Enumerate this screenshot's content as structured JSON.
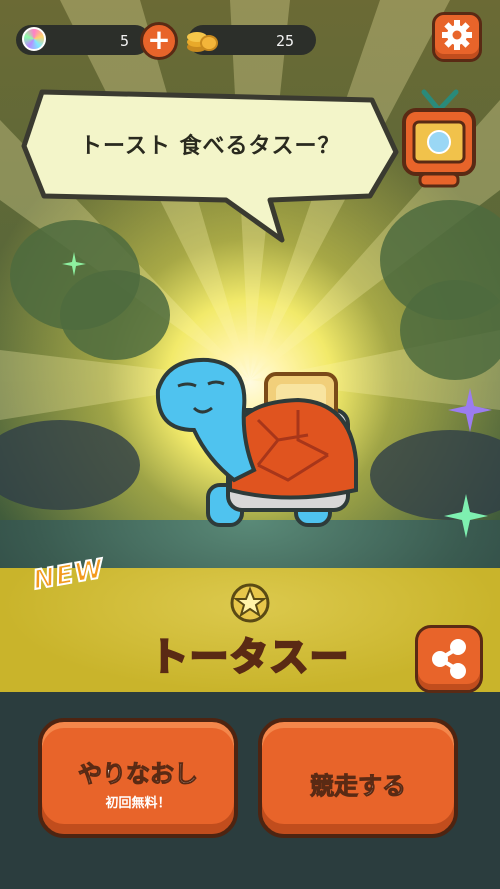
{
  "top_bar": {
    "gems_count": "5",
    "coins_count": "25"
  },
  "speech_bubble": {
    "text": "トースト 食べるタスー？"
  },
  "reveal": {
    "new_label": "NEW",
    "character_name": "トータスー"
  },
  "buttons": {
    "retry_label": "やりなおし",
    "retry_sub_label": "初回無料！",
    "race_label": "競走する"
  },
  "icons": {
    "gem": "gem-icon",
    "plus": "plus-icon",
    "coins": "coin-stack-icon",
    "settings": "gear-icon",
    "tv": "tv-icon",
    "star": "star-badge-icon",
    "share": "share-icon"
  },
  "colors": {
    "button_orange": "#e8642a",
    "outline_brown": "#5a2a14",
    "banner_yellow": "#c9b42b",
    "turtle_blue": "#4fc3ef",
    "shell_orange": "#e0541f"
  }
}
